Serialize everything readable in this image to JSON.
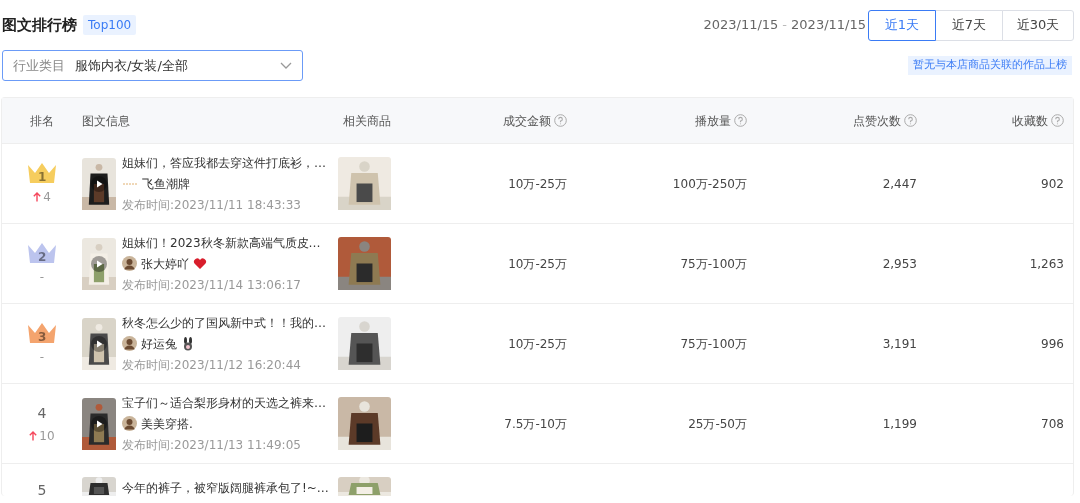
{
  "header": {
    "title": "图文排行榜",
    "badge": "Top100",
    "date_start": "2023/11/15",
    "date_sep": "-",
    "date_end": "2023/11/15",
    "ranges": [
      {
        "label": "近1天",
        "selected": true
      },
      {
        "label": "近7天",
        "selected": false
      },
      {
        "label": "近30天",
        "selected": false
      }
    ]
  },
  "filter": {
    "label": "行业类目",
    "value": "服饰内衣/女装/全部"
  },
  "notice": "暂无与本店商品关联的作品上榜",
  "table": {
    "columns": [
      {
        "label": "排名",
        "help": false
      },
      {
        "label": "图文信息",
        "help": false
      },
      {
        "label": "相关商品",
        "help": false
      },
      {
        "label": "成交金额",
        "help": true
      },
      {
        "label": "播放量",
        "help": true
      },
      {
        "label": "点赞次数",
        "help": true
      },
      {
        "label": "收藏数",
        "help": true
      }
    ],
    "rows": [
      {
        "rank": "1",
        "color": "#f6cd5e",
        "rising": true,
        "change": "4",
        "title": "姐妹们，答应我都去穿这件打底衫，…",
        "avatar": false,
        "author": "飞鱼潮牌",
        "emoji": false,
        "published": "发布时间:2023/11/11 18:43:33",
        "amount": "10万-25万",
        "plays": "100万-250万",
        "likes": "2,447",
        "favorites": "902"
      },
      {
        "rank": "2",
        "color": "#bcc4ee",
        "rising": false,
        "change": "-",
        "title": "姐妹们！2023秋冬新款高端气质皮…",
        "avatar": true,
        "author": "张大婷吖",
        "emoji": true,
        "published": "发布时间:2023/11/14 13:06:17",
        "amount": "10万-25万",
        "plays": "75万-100万",
        "likes": "2,953",
        "favorites": "1,263"
      },
      {
        "rank": "3",
        "color": "#f4a46e",
        "rising": false,
        "change": "-",
        "title": "秋冬怎么少的了国风新中式！！我的…",
        "avatar": true,
        "author": "好运兔",
        "emoji": true,
        "published": "发布时间:2023/11/12 16:20:44",
        "amount": "10万-25万",
        "plays": "75万-100万",
        "likes": "3,191",
        "favorites": "996"
      },
      {
        "rank": "4",
        "rising": true,
        "change": "10",
        "title": "宝子们～适合梨形身材的天选之裤来…",
        "avatar": true,
        "author": "美美穿搭.",
        "emoji": false,
        "published": "发布时间:2023/11/13 11:49:05",
        "amount": "7.5万-10万",
        "plays": "25万-50万",
        "likes": "1,199",
        "favorites": "708"
      },
      {
        "rank": "5",
        "title": "今年的裤子，被窄版阔腿裤承包了!~…"
      }
    ]
  }
}
